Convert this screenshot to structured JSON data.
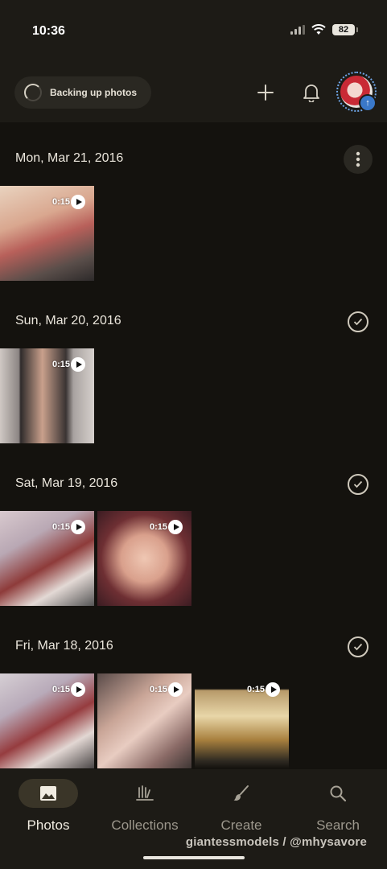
{
  "status_bar": {
    "time": "10:36",
    "battery": "82"
  },
  "top_bar": {
    "backup_label": "Backing up photos",
    "add_icon": "plus-icon",
    "bell_icon": "bell-icon"
  },
  "colors": {
    "accent": "#3a78c9",
    "background": "#14120e",
    "surface": "#1d1b16",
    "active_pill": "#3a3528"
  },
  "days": [
    {
      "label": "Mon, Mar 21, 2016",
      "action_icon": "more-vert-icon",
      "items": [
        {
          "duration": "0:15"
        }
      ]
    },
    {
      "label": "Sun, Mar 20, 2016",
      "action_icon": "check-circle-icon",
      "items": [
        {
          "duration": "0:15"
        }
      ]
    },
    {
      "label": "Sat, Mar 19, 2016",
      "action_icon": "check-circle-icon",
      "items": [
        {
          "duration": "0:15"
        },
        {
          "duration": "0:15"
        }
      ]
    },
    {
      "label": "Fri, Mar 18, 2016",
      "action_icon": "check-circle-icon",
      "items": [
        {
          "duration": "0:15"
        },
        {
          "duration": "0:15"
        },
        {
          "duration": "0:15"
        }
      ]
    }
  ],
  "nav": [
    {
      "label": "Photos",
      "icon": "photo-icon",
      "active": true
    },
    {
      "label": "Collections",
      "icon": "collections-icon",
      "active": false
    },
    {
      "label": "Create",
      "icon": "brush-icon",
      "active": false
    },
    {
      "label": "Search",
      "icon": "search-icon",
      "active": false
    }
  ],
  "watermark": "giantessmodels / @mhysavore"
}
